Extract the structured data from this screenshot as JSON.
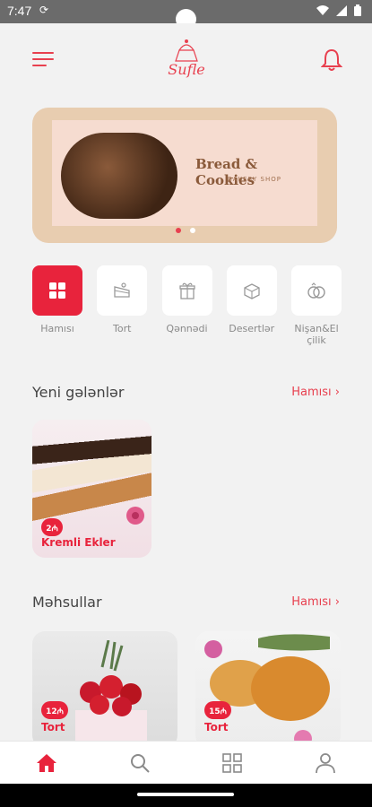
{
  "status_bar": {
    "time": "7:47"
  },
  "header": {
    "logo_text": "Sufle"
  },
  "banner": {
    "title": "Bread & Cookies",
    "subtitle": "BAKERY SHOP"
  },
  "categories": [
    {
      "label": "Hamısı",
      "icon": "grid-icon"
    },
    {
      "label": "Tort",
      "icon": "cake-slice-icon"
    },
    {
      "label": "Qənnədi",
      "icon": "gift-box-icon"
    },
    {
      "label": "Desertlər",
      "icon": "dessert-box-icon"
    },
    {
      "label": "Nişan&El çilik",
      "icon": "rings-icon"
    }
  ],
  "new_section": {
    "title": "Yeni gələnlər",
    "see_all": "Hamısı ›",
    "items": [
      {
        "name": "Kremli Ekler",
        "price": "2₼"
      }
    ]
  },
  "products_section": {
    "title": "Məhsullar",
    "see_all": "Hamısı ›",
    "items": [
      {
        "name": "Tort",
        "price": "12₼"
      },
      {
        "name": "Tort",
        "price": "15₼"
      }
    ]
  },
  "colors": {
    "accent": "#e8233c",
    "background": "#f2f2f2"
  }
}
